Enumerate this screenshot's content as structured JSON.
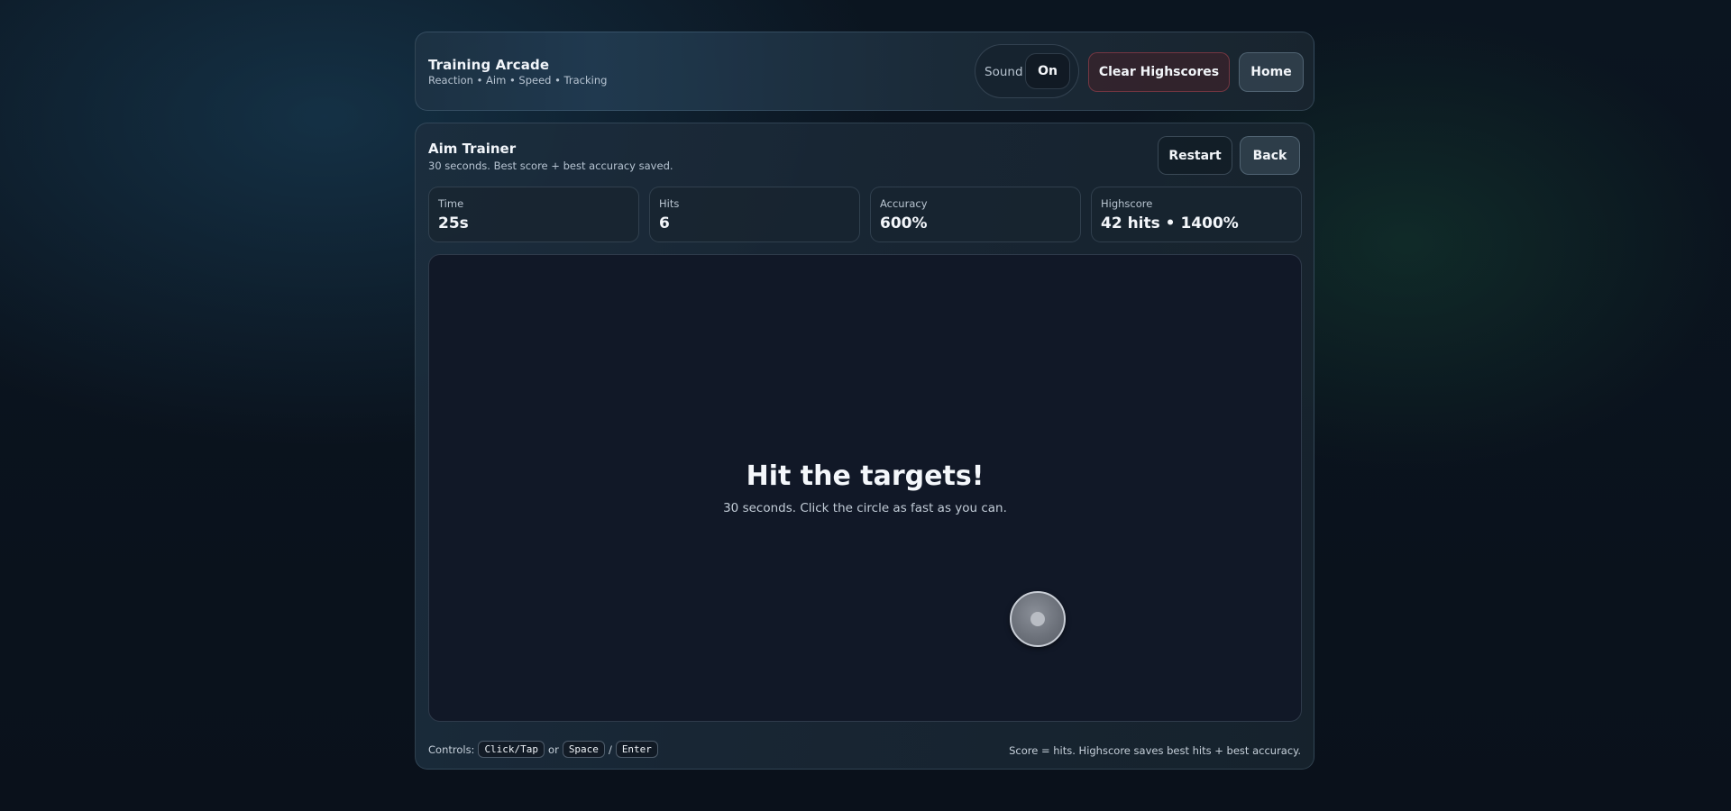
{
  "header": {
    "title": "Training Arcade",
    "subtitle": "Reaction • Aim • Speed • Tracking",
    "sound_label": "Sound",
    "sound_state": "On",
    "clear_label": "Clear Highscores",
    "home_label": "Home"
  },
  "game": {
    "title": "Aim Trainer",
    "subtitle": "30 seconds. Best score + best accuracy saved.",
    "restart_label": "Restart",
    "back_label": "Back",
    "stats": [
      {
        "label": "Time",
        "value": "25s"
      },
      {
        "label": "Hits",
        "value": "6"
      },
      {
        "label": "Accuracy",
        "value": "600%"
      },
      {
        "label": "Highscore",
        "value": "42 hits • 1400%"
      }
    ],
    "arena": {
      "heading": "Hit the targets!",
      "instructions": "30 seconds. Click the circle as fast as you can."
    }
  },
  "footer": {
    "controls_prefix": "Controls:",
    "key_click": "Click/Tap",
    "or_text": "or",
    "key_space": "Space",
    "slash": "/",
    "key_enter": "Enter",
    "note": "Score = hits. Highscore saves best hits + best accuracy."
  },
  "colors": {
    "danger_border": "#c8505a",
    "arena_bg": "#111827",
    "target_ring": "#c9ced6"
  }
}
